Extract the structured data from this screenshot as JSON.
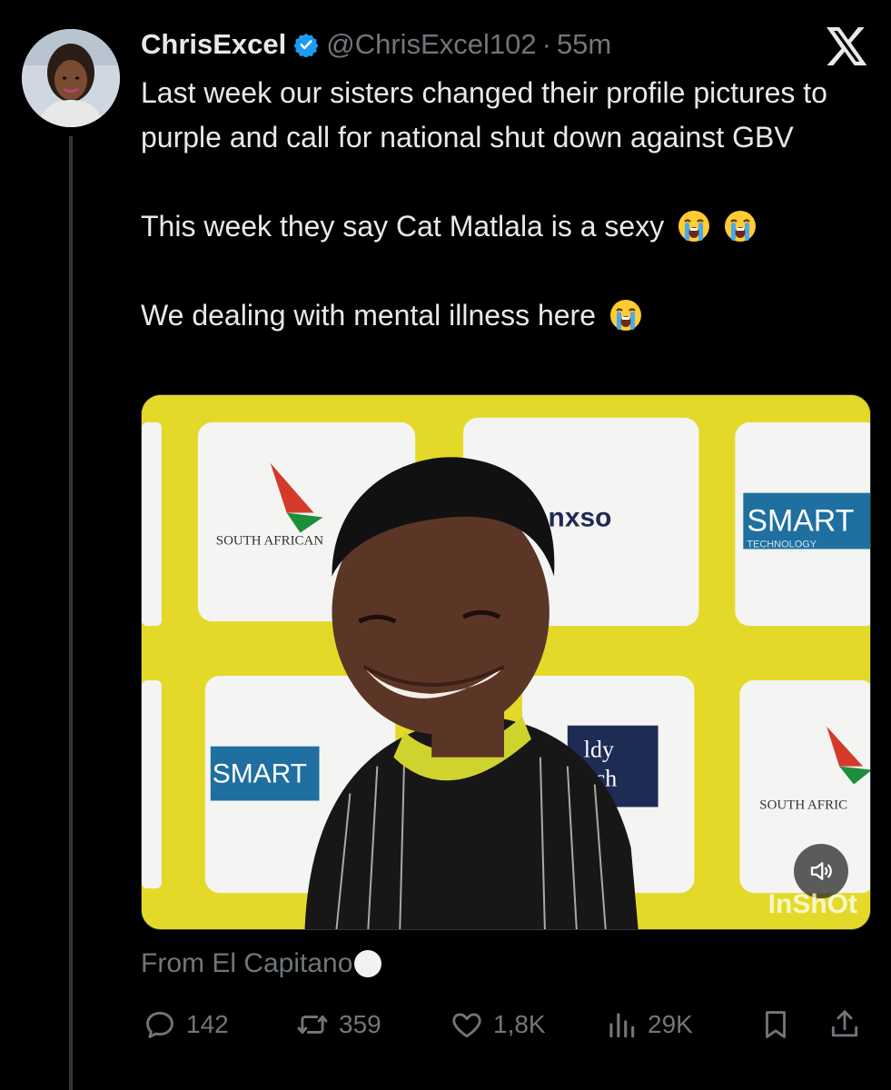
{
  "post": {
    "display_name": "ChrisExcel",
    "handle": "@ChrisExcel102",
    "separator": "·",
    "time": "55m",
    "text_lines": [
      "Last week our sisters changed their profile pictures to purple and call for national shut down against GBV",
      "This week they say Cat Matlala is a sexy",
      "We dealing with mental illness here"
    ],
    "caption": "From El Capitano",
    "verified": true
  },
  "media": {
    "watermark": "InShOt",
    "sponsor_texts": [
      "SOUTH AFRICAN",
      "anxso",
      "SMART",
      "TECHNOLOGY",
      "ldy",
      "ch",
      "SOUTH AFRIC"
    ]
  },
  "actions": {
    "replies": "142",
    "reposts": "359",
    "likes": "1,8K",
    "views": "29K"
  },
  "icons": {
    "brand": "x-logo-icon",
    "verified": "verified-badge-icon",
    "emoji": "loudly-crying-face-emoji",
    "sound": "volume-icon",
    "reply": "reply-icon",
    "repost": "repost-icon",
    "like": "heart-icon",
    "views": "views-chart-icon",
    "bookmark": "bookmark-icon",
    "share": "share-icon"
  },
  "colors": {
    "background": "#000000",
    "text": "#e7e9ea",
    "muted": "#71767b",
    "verified": "#1d9bf0",
    "media_backdrop": "#e5db2c"
  }
}
